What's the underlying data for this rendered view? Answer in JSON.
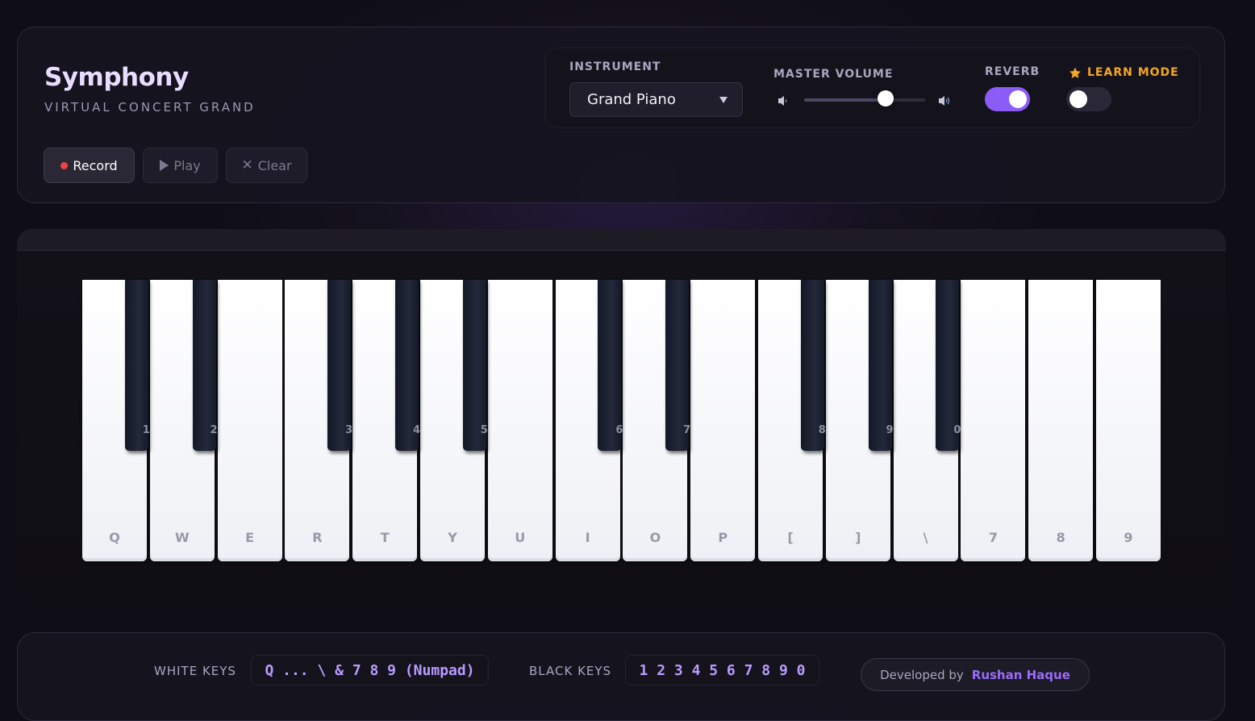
{
  "header": {
    "title": "Symphony",
    "subtitle": "VIRTUAL CONCERT GRAND",
    "record_label": "Record",
    "play_label": "Play",
    "clear_label": "Clear"
  },
  "controls": {
    "instrument_label": "INSTRUMENT",
    "instrument_value": "Grand Piano",
    "volume_label": "MASTER VOLUME",
    "volume_level": 0.67,
    "reverb_label": "REVERB",
    "reverb_on": true,
    "learn_label": "LEARN MODE",
    "learn_on": false,
    "accent_color": "#8b5cf6",
    "learn_color": "#f5a623"
  },
  "keyboard": {
    "white_keys": [
      "Q",
      "W",
      "E",
      "R",
      "T",
      "Y",
      "U",
      "I",
      "O",
      "P",
      "[",
      "]",
      "\\",
      "7",
      "8",
      "9"
    ],
    "black_keys": [
      {
        "after": 0,
        "label": "1"
      },
      {
        "after": 1,
        "label": "2"
      },
      {
        "after": 3,
        "label": "3"
      },
      {
        "after": 4,
        "label": "4"
      },
      {
        "after": 5,
        "label": "5"
      },
      {
        "after": 7,
        "label": "6"
      },
      {
        "after": 8,
        "label": "7"
      },
      {
        "after": 10,
        "label": "8"
      },
      {
        "after": 11,
        "label": "9"
      },
      {
        "after": 12,
        "label": "0"
      }
    ]
  },
  "footer": {
    "white_label": "WHITE KEYS",
    "white_value": "Q ... \\ & 7 8 9 (Numpad)",
    "black_label": "BLACK KEYS",
    "black_value": "1 2 3 4 5 6 7 8 9 0",
    "credit_prefix": "Developed by",
    "credit_name": "Rushan Haque"
  }
}
